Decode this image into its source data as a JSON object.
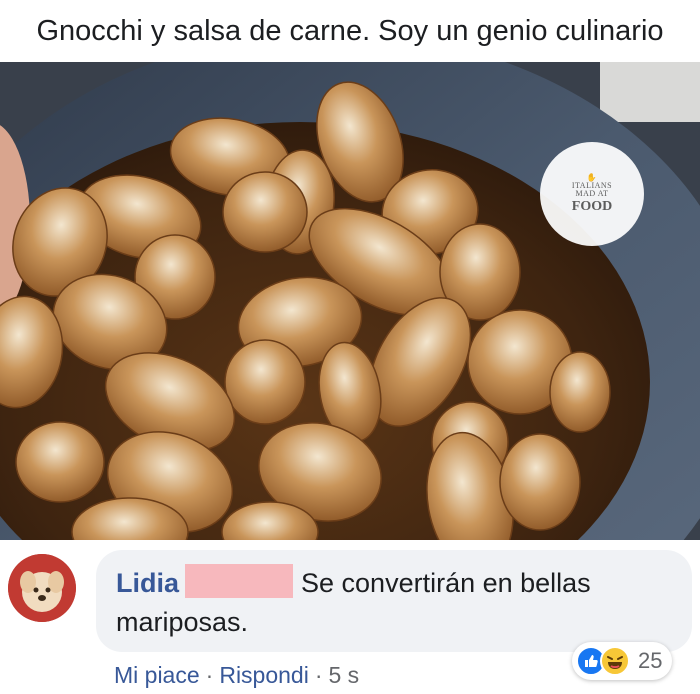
{
  "post": {
    "caption": "Gnocchi y salsa de carne. Soy un genio culinario"
  },
  "watermark": {
    "line1": "ITALIANS",
    "line2": "MAD AT",
    "line3": "FOOD"
  },
  "comment": {
    "author": "Lidia",
    "text": "Se convertirán en bellas mariposas.",
    "actions": {
      "like": "Mi piace",
      "separator": "·",
      "reply": "Rispondi",
      "time": "5 s"
    },
    "reactions": {
      "count": "25",
      "icons": [
        "like-icon",
        "haha-icon"
      ]
    }
  },
  "colors": {
    "link": "#385898",
    "bubble": "#f0f2f5",
    "redaction": "#f7b8bd",
    "like": "#1877f2",
    "haha": "#f7c737"
  }
}
